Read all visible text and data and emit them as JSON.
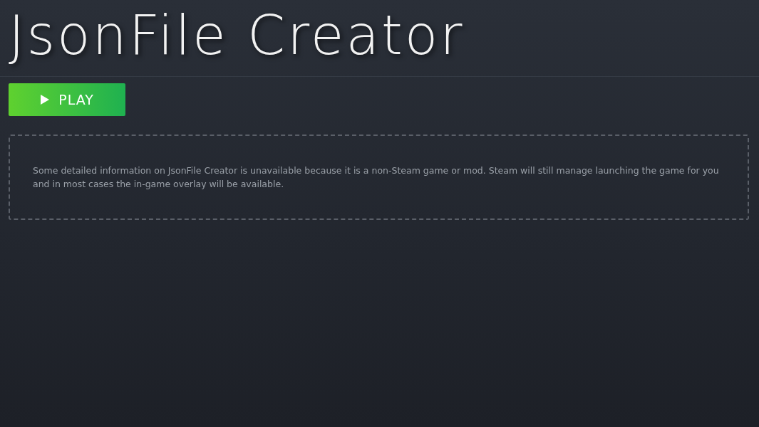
{
  "game": {
    "title": "JsonFile Creator"
  },
  "play_button": {
    "label": "PLAY"
  },
  "notice": {
    "text": "Some detailed information on JsonFile Creator is unavailable because it is a non-Steam game or mod. Steam will still manage launching the game for you and in most cases the in-game overlay will be available."
  }
}
